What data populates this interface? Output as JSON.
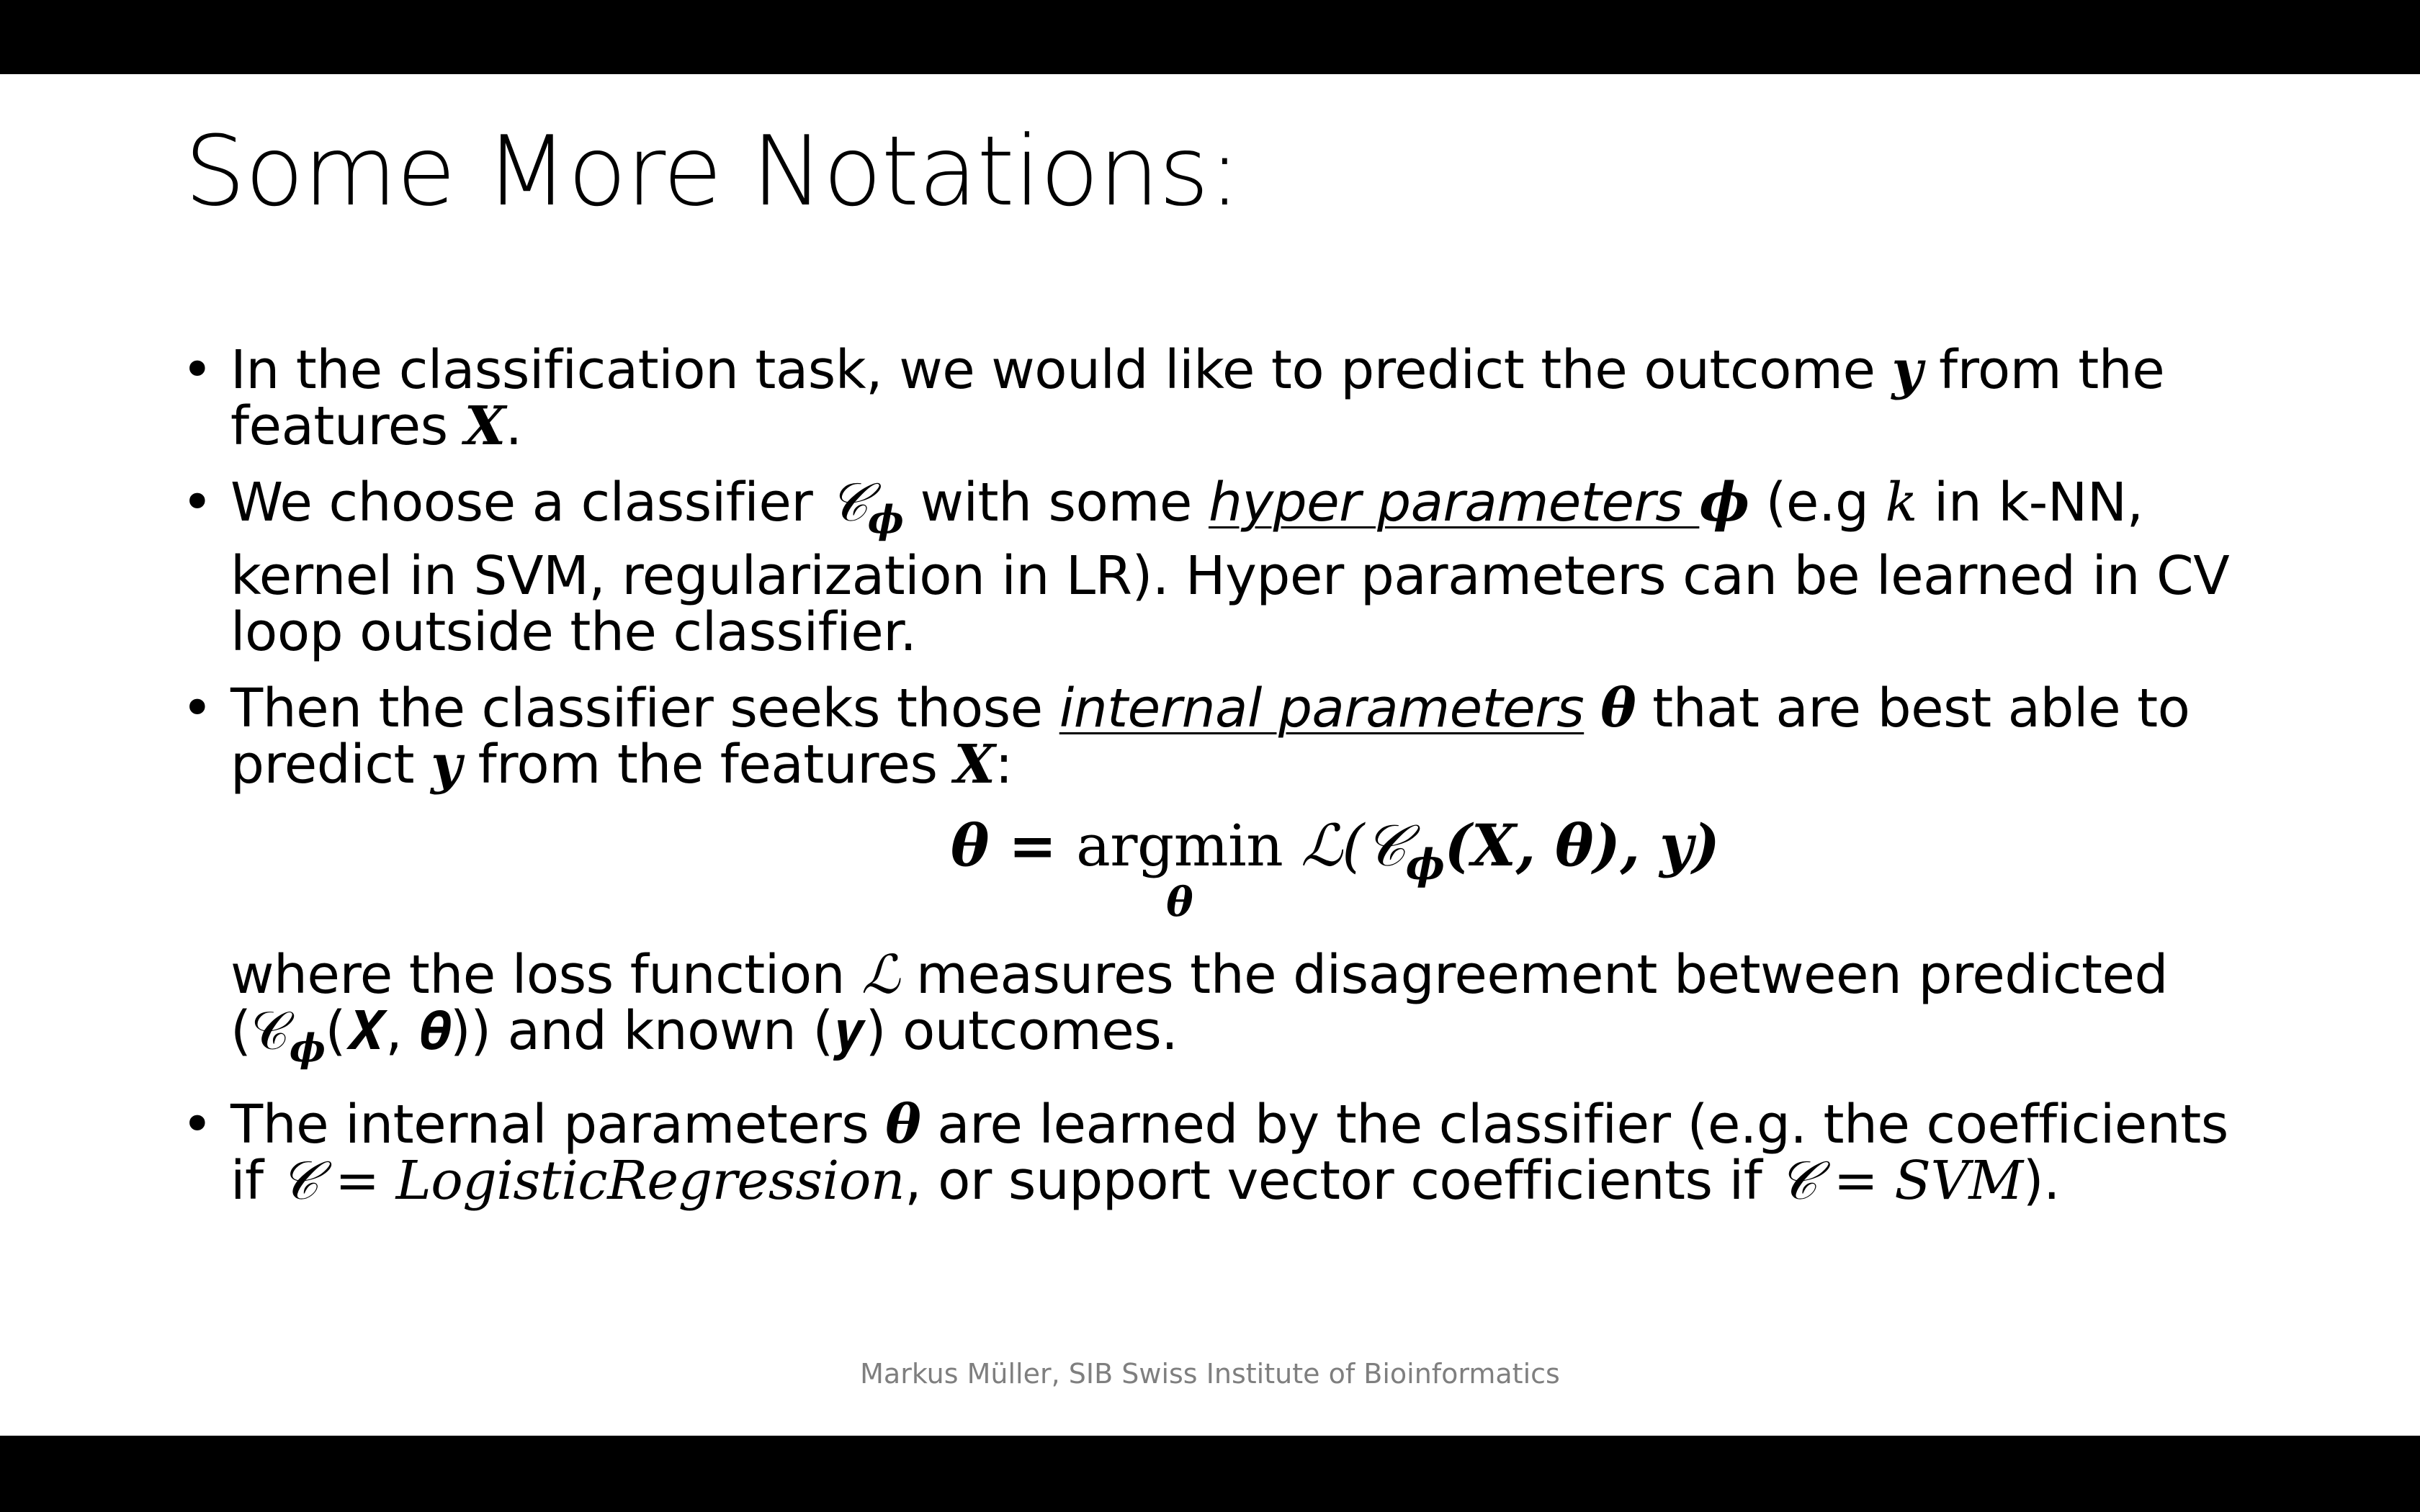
{
  "slide": {
    "title": "Some More Notations:",
    "bullet_symbol": "•",
    "bullet1": {
      "text_a": "In the classification task, we would like to predict the outcome ",
      "y": "𝒚",
      "text_b": " from the features ",
      "X": "𝑿",
      "text_c": "."
    },
    "bullet2": {
      "text_a": "We choose a classifier ",
      "C": "𝒞",
      "phi_sub": "𝝓",
      "text_b": " with some ",
      "link_text": "hyper parameters ",
      "phi": "𝝓",
      "text_c": " (e.g ",
      "k": "𝑘",
      "text_d": " in k-NN, kernel in SVM, regularization in LR). Hyper parameters can be learned in CV loop outside the classifier."
    },
    "bullet3": {
      "text_a": "Then the classifier seeks those ",
      "link_text": "internal parameters",
      "theta": "𝜽",
      "text_b": " that are best able to predict ",
      "y": "𝒚",
      "text_c": " from the features ",
      "X": "𝑿",
      "text_d": ":"
    },
    "equation": {
      "lhs": "𝜽 = ",
      "argmin": "argmin",
      "argmin_sub": "𝜽",
      "rhs": " ℒ(𝒞",
      "rhs_sub": "𝝓",
      "rhs_tail": "(𝑿, 𝜽), 𝒚)"
    },
    "continuation": {
      "text_a": "where the loss function ",
      "L": "ℒ",
      "text_b": " measures the disagreement between predicted (𝒞",
      "phi_sub": "𝝓",
      "text_c": "(𝑿, 𝜽)) and known (𝒚) outcomes."
    },
    "bullet4": {
      "text_a": "The internal parameters ",
      "theta": "𝜽",
      "text_b": " are learned by the classifier (e.g. the coefficients if ",
      "eq1": "𝒞 = 𝐿𝑜𝑔𝑖𝑠𝑡𝑖𝑐𝑅𝑒𝑔𝑟𝑒𝑠𝑠𝑖𝑜𝑛",
      "text_c": ", or support vector coefficients if ",
      "eq2": "𝒞 = 𝑆𝑉𝑀",
      "text_d": ")."
    },
    "footer": "Markus Müller, SIB Swiss Institute of Bioinformatics"
  }
}
